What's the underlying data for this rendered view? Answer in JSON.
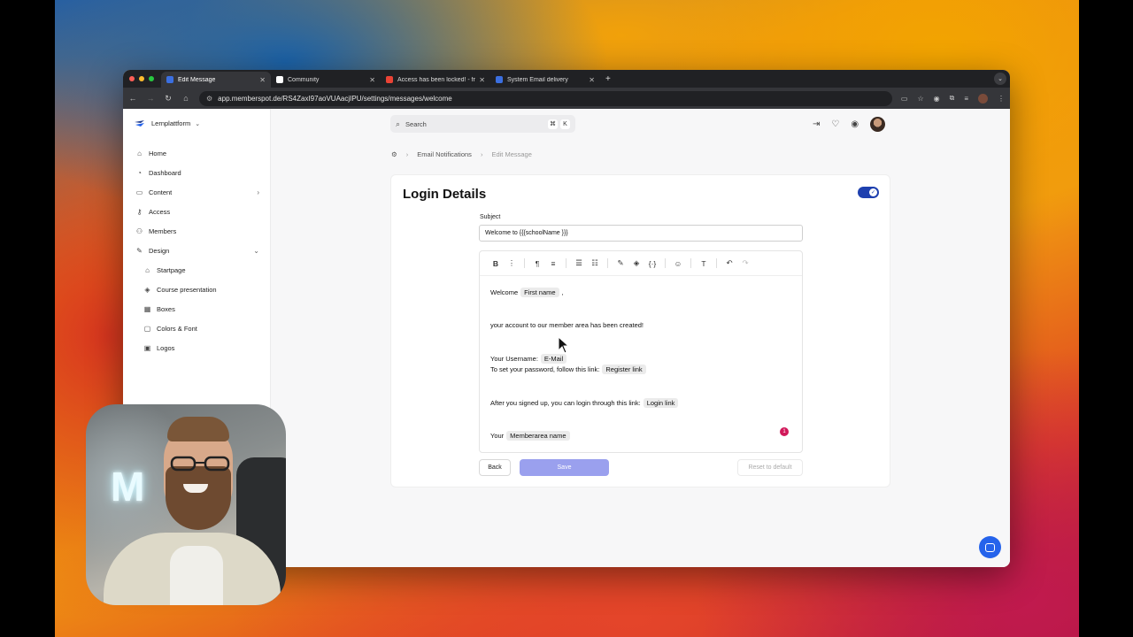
{
  "browser": {
    "tabs": [
      {
        "label": "Edit Message",
        "fav_color": "#3b6fe0",
        "active": true
      },
      {
        "label": "Community",
        "fav_color": "#ffffff",
        "active": false
      },
      {
        "label": "Access has been locked! - fr...",
        "fav_color": "#ea4335",
        "active": false
      },
      {
        "label": "System Email delivery",
        "fav_color": "#3b6fe0",
        "active": false
      }
    ],
    "url": "app.memberspot.de/RS4ZaxI97aoVUAacjIPU/settings/messages/welcome"
  },
  "sidebar": {
    "brand": "Lernplattform",
    "items": [
      {
        "label": "Home",
        "icon": "home-icon"
      },
      {
        "label": "Dashboard",
        "icon": "dashboard-icon"
      },
      {
        "label": "Content",
        "icon": "folder-icon"
      },
      {
        "label": "Access",
        "icon": "key-icon"
      },
      {
        "label": "Members",
        "icon": "members-icon"
      },
      {
        "label": "Design",
        "icon": "pen-icon"
      }
    ],
    "design_items": [
      {
        "label": "Startpage",
        "icon": "home-icon"
      },
      {
        "label": "Course presentation",
        "icon": "layers-icon"
      },
      {
        "label": "Boxes",
        "icon": "boxes-icon"
      },
      {
        "label": "Colors & Font",
        "icon": "palette-icon"
      },
      {
        "label": "Logos",
        "icon": "image-icon"
      }
    ]
  },
  "search": {
    "placeholder": "Search",
    "key1": "⌘",
    "key2": "K"
  },
  "breadcrumb": {
    "section": "Email Notifications",
    "current": "Edit Message"
  },
  "card": {
    "title": "Login Details",
    "toggle_on": true,
    "subject_label": "Subject",
    "subject_value": "Welcome to {{{schoolName }}}",
    "body": {
      "line1_text": "Welcome",
      "line1_chip": "First name",
      "line1_end": ",",
      "line2": "your account to our member area has been created!",
      "line3_text": "Your Username:",
      "line3_chip": "E-Mail",
      "line4_text": "To set your password, follow this link:",
      "line4_chip": "Register link",
      "line5_text": "After you signed up, you can login through this link:",
      "line5_chip": "Login link",
      "line6_text": "Your",
      "line6_chip": "Memberarea name",
      "badge": "1"
    },
    "buttons": {
      "back": "Back",
      "save": "Save",
      "reset": "Reset to default"
    }
  },
  "colors": {
    "accent": "#1e40af",
    "save": "#9aa0ee",
    "chat": "#2563eb",
    "badge": "#d1185a"
  }
}
